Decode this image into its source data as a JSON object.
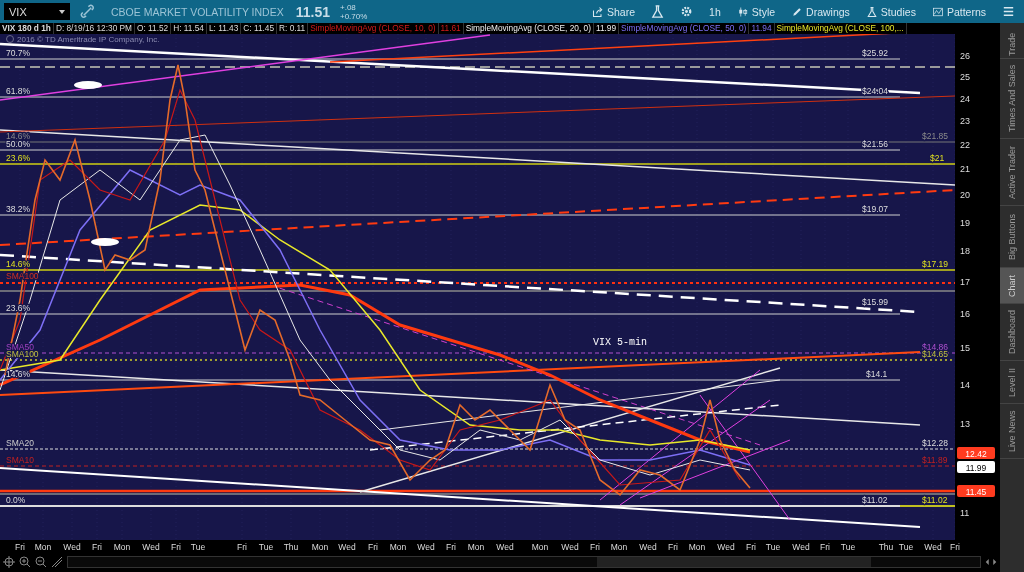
{
  "toolbar": {
    "symbol": "VIX",
    "description": "CBOE MARKET VOLATILITY INDEX",
    "last": "11.51",
    "change": "+.08",
    "change_pct": "+0.70%",
    "share": "Share",
    "interval": "1h",
    "style": "Style",
    "drawings": "Drawings",
    "studies": "Studies",
    "patterns": "Patterns"
  },
  "legend": {
    "title": "VIX 180 d 1h",
    "fields": [
      "D: 8/19/16 12:30 PM",
      "O: 11.52",
      "H: 11.54",
      "L: 11.43",
      "C: 11.45",
      "R: 0.11"
    ],
    "studies": [
      {
        "name": "SimpleMovingAvg (CLOSE, 10, 0)",
        "value": "11.61"
      },
      {
        "name": "SimpleMovingAvg (CLOSE, 20, 0)",
        "value": "11.99"
      },
      {
        "name": "SimpleMovingAvg (CLOSE, 50, 0)",
        "value": "11.94"
      },
      {
        "name": "SimpleMovingAvg (CLOSE, 100,..."
      }
    ]
  },
  "chart": {
    "copyright": "2016 © TD Ameritrade IP Company, Inc.",
    "note": "VIX 5-min",
    "left_labels": [
      "70.7%",
      "61.8%",
      "14.6%",
      "50.0%",
      "23.6%",
      "38.2%",
      "14.6%",
      "SMA100",
      "23.6%",
      "SMA50",
      "SMA100",
      "14.6%",
      "SMA20",
      "SMA10",
      "0.0%"
    ],
    "right_labels": [
      "$25.92",
      "$24.04",
      "$21.85",
      "$21.56",
      "$21",
      "$19.07",
      "$17.19",
      "$15.99",
      "$14.86",
      "$14.65",
      "$14.1",
      "$12.28",
      "$11.89",
      "$11.02",
      "$11.02"
    ],
    "price_ticks": [
      "26",
      "25",
      "24",
      "23",
      "22",
      "21",
      "20",
      "19",
      "18",
      "17",
      "16",
      "15",
      "14",
      "13",
      "11"
    ],
    "price_tags": [
      {
        "text": "12.42",
        "color": "#ff3b1f"
      },
      {
        "text": "11.99",
        "color": "#ffffff"
      },
      {
        "text": "11.45",
        "color": "#ff3b1f"
      }
    ],
    "day_ticks": [
      "Fri",
      "Mon",
      "Wed",
      "Fri",
      "Mon",
      "Wed",
      "Fri",
      "Tue",
      "Fri",
      "Tue",
      "Thu",
      "Mon",
      "Wed",
      "Fri",
      "Mon",
      "Wed",
      "Fri",
      "Mon",
      "Wed",
      "Mon",
      "Wed",
      "Fri",
      "Mon",
      "Wed",
      "Fri",
      "Mon",
      "Wed",
      "Fri",
      "Tue",
      "Wed",
      "Fri",
      "Tue",
      "Thu",
      "Tue",
      "Wed",
      "Fri"
    ]
  },
  "side_tabs": [
    {
      "label": "Trade",
      "selected": false
    },
    {
      "label": "Times And Sales",
      "selected": false
    },
    {
      "label": "Active Trader",
      "selected": false
    },
    {
      "label": "Big Buttons",
      "selected": false
    },
    {
      "label": "Chart",
      "selected": true
    },
    {
      "label": "Dashboard",
      "selected": false
    },
    {
      "label": "Level II",
      "selected": false
    },
    {
      "label": "Live News",
      "selected": false
    }
  ]
}
